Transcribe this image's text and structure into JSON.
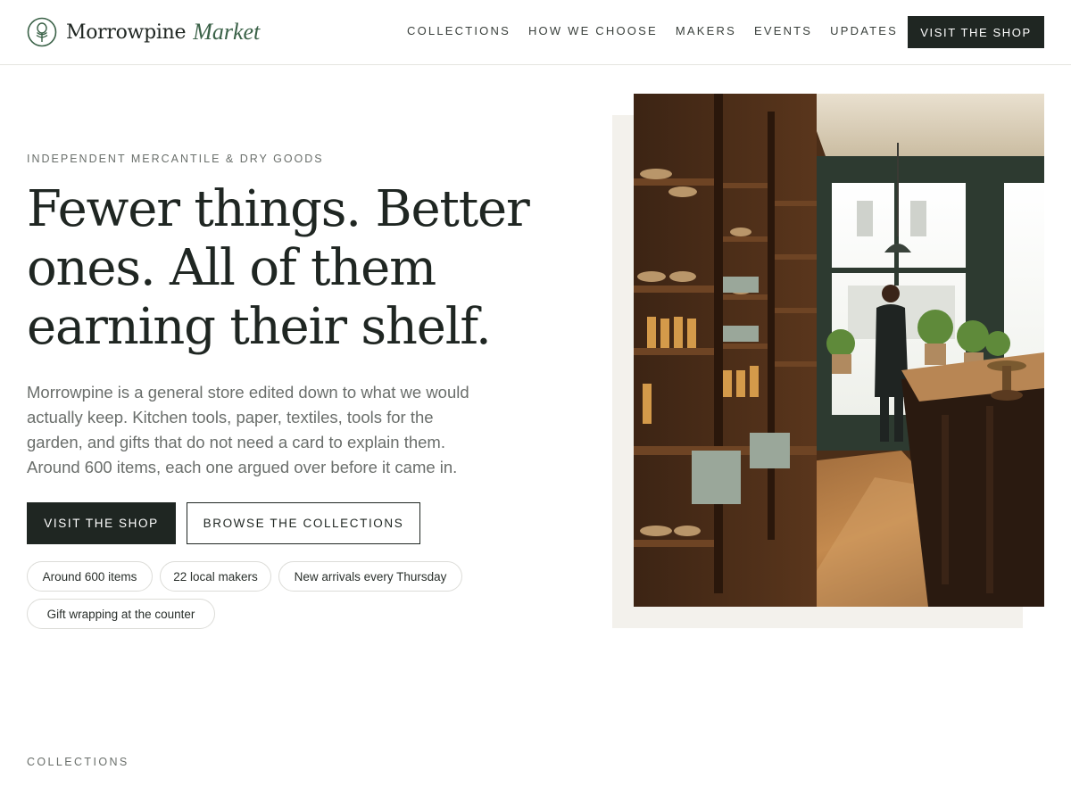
{
  "brand": {
    "name": "Morrowpine",
    "accent": "Market",
    "icon": "tree-in-circle-icon",
    "accent_color": "#3b6248"
  },
  "nav": {
    "items": [
      {
        "label": "COLLECTIONS"
      },
      {
        "label": "HOW WE CHOOSE"
      },
      {
        "label": "MAKERS"
      },
      {
        "label": "EVENTS"
      },
      {
        "label": "UPDATES"
      }
    ],
    "cta": "VISIT THE SHOP"
  },
  "hero": {
    "eyebrow": "INDEPENDENT MERCANTILE & DRY GOODS",
    "headline_lines": [
      "Fewer things. Better",
      "ones. All of them",
      "earning their shelf."
    ],
    "lede_lines": [
      "Morrowpine is a general store edited down to what we would",
      "actually keep. Kitchen tools, paper, textiles, tools for the",
      "garden, and gifts that do not need a card to explain them.",
      "Around 600 items, each one argued over before it came in."
    ],
    "primary_button": "VISIT THE SHOP",
    "secondary_button": "BROWSE THE COLLECTIONS",
    "chips": [
      "Around 600 items",
      "22 local makers",
      "New arrivals every Thursday",
      "Gift wrapping at the counter"
    ],
    "image_alt": "store-interior-photo"
  },
  "sections": {
    "collections_label": "COLLECTIONS"
  },
  "colors": {
    "ink": "#1f2622",
    "muted": "#6a6e6b",
    "panel": "#f3f1ec"
  }
}
